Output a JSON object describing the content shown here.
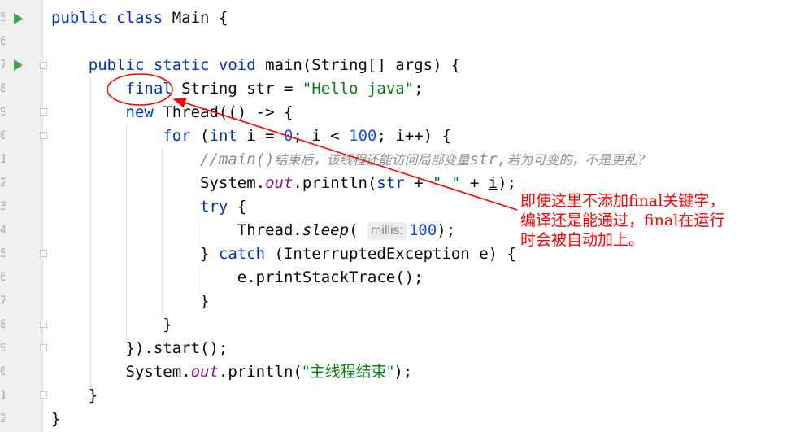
{
  "editor": {
    "line_number_digits": [
      "5",
      "6",
      "7",
      "8",
      "9",
      "0",
      "1",
      "2",
      "3",
      "4",
      "5",
      "6",
      "7",
      "8",
      "9",
      "0",
      "1",
      "2"
    ],
    "lines": [
      [
        [
          "kw",
          "public class "
        ],
        [
          "",
          "Main {"
        ]
      ],
      [],
      [
        [
          "",
          "    "
        ],
        [
          "kw",
          "public static void "
        ],
        [
          "",
          "main(String[] args) {"
        ]
      ],
      [
        [
          "",
          "        "
        ],
        [
          "kw",
          "final"
        ],
        [
          "",
          " String str = "
        ],
        [
          "str",
          "\"Hello java\""
        ],
        [
          "",
          ";"
        ]
      ],
      [
        [
          "",
          "        "
        ],
        [
          "kw",
          "new "
        ],
        [
          "",
          "Thread(() -> {"
        ]
      ],
      [
        [
          "",
          "            "
        ],
        [
          "kw",
          "for "
        ],
        [
          "",
          "("
        ],
        [
          "kw",
          "int "
        ],
        [
          "loc",
          "i"
        ],
        [
          "",
          " = "
        ],
        [
          "num",
          "0"
        ],
        [
          "",
          "; "
        ],
        [
          "loc",
          "i"
        ],
        [
          "",
          " < "
        ],
        [
          "num",
          "100"
        ],
        [
          "",
          "; "
        ],
        [
          "loc",
          "i"
        ],
        [
          "",
          "++) {"
        ]
      ],
      [
        [
          "",
          "                "
        ],
        [
          "cmt",
          "//main()"
        ],
        [
          "cmt cmt-cjk",
          "结束后，该线程还能访问局部变量"
        ],
        [
          "cmt",
          "str,"
        ],
        [
          "cmt cmt-cjk",
          "若为可变的，不是更乱？"
        ]
      ],
      [
        [
          "",
          "                System."
        ],
        [
          "fld",
          "out"
        ],
        [
          "",
          ".println("
        ],
        [
          "kw",
          "str"
        ],
        [
          "",
          " + "
        ],
        [
          "str",
          "\" \""
        ],
        [
          "",
          " + "
        ],
        [
          "loc",
          "i"
        ],
        [
          "",
          ");"
        ]
      ],
      [
        [
          "",
          "                "
        ],
        [
          "kw",
          "try "
        ],
        [
          "",
          "{"
        ]
      ],
      [
        [
          "",
          "                    Thread."
        ],
        [
          "itc",
          "sleep"
        ],
        [
          "",
          "( "
        ],
        [
          "hint",
          "millis:"
        ],
        [
          "num",
          "100"
        ],
        [
          "",
          ");"
        ]
      ],
      [
        [
          "",
          "                } "
        ],
        [
          "kw",
          "catch "
        ],
        [
          "",
          "(InterruptedException e) {"
        ]
      ],
      [
        [
          "",
          "                    e.printStackTrace();"
        ]
      ],
      [
        [
          "",
          "                }"
        ]
      ],
      [
        [
          "",
          "            }"
        ]
      ],
      [
        [
          "",
          "        }).start();"
        ]
      ],
      [
        [
          "",
          "        System."
        ],
        [
          "fld",
          "out"
        ],
        [
          "",
          ".println("
        ],
        [
          "str cjk",
          "\"主线程结束\""
        ],
        [
          "",
          ");"
        ]
      ],
      [
        [
          "",
          "    }"
        ]
      ],
      [
        [
          "",
          "}"
        ]
      ]
    ]
  },
  "annotation": {
    "text": "即使这里不添加final关键字，\n编译还是能通过，final在运行\n时会被自动加上。",
    "color": "#ff0000"
  }
}
